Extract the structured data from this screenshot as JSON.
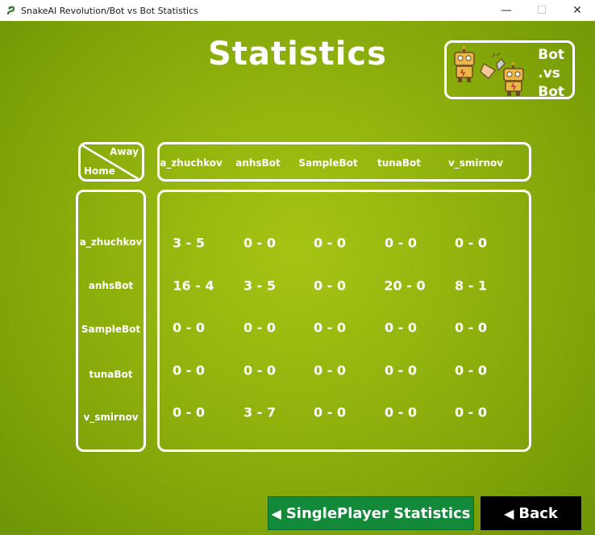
{
  "window": {
    "title": "SnakeAI Revolution/Bot vs Bot Statistics",
    "minimize_glyph": "—",
    "maximize_glyph": "☐",
    "close_glyph": "✕"
  },
  "page": {
    "title": "Statistics"
  },
  "mode_card": {
    "line1": "Bot",
    "line2": ".vs",
    "line3": "Bot",
    "icon": "robots-handshake-icon"
  },
  "table": {
    "corner_away": "Away",
    "corner_home": "Home",
    "columns": [
      "a_zhuchkov",
      "anhsBot",
      "SampleBot",
      "tunaBot",
      "v_smirnov"
    ],
    "rows": [
      {
        "name": "a_zhuchkov",
        "scores": [
          "3 - 5",
          "0 - 0",
          "0 - 0",
          "0 - 0",
          "0 - 0"
        ]
      },
      {
        "name": "anhsBot",
        "scores": [
          "16 - 4",
          "3 - 5",
          "0 - 0",
          "20 - 0",
          "8 - 1"
        ]
      },
      {
        "name": "SampleBot",
        "scores": [
          "0 - 0",
          "0 - 0",
          "0 - 0",
          "0 - 0",
          "0 - 0"
        ]
      },
      {
        "name": "tunaBot",
        "scores": [
          "0 - 0",
          "0 - 0",
          "0 - 0",
          "0 - 0",
          "0 - 0"
        ]
      },
      {
        "name": "v_smirnov",
        "scores": [
          "0 - 0",
          "3 - 7",
          "0 - 0",
          "0 - 0",
          "0 - 0"
        ]
      }
    ]
  },
  "buttons": {
    "singleplayer": "SinglePlayer Statistics",
    "back": "Back",
    "arrow_glyph": "◀"
  },
  "colors": {
    "background": "#8fb10d",
    "singleplayer_button": "#138a3a",
    "back_button": "#000000",
    "text": "#ffffff"
  }
}
